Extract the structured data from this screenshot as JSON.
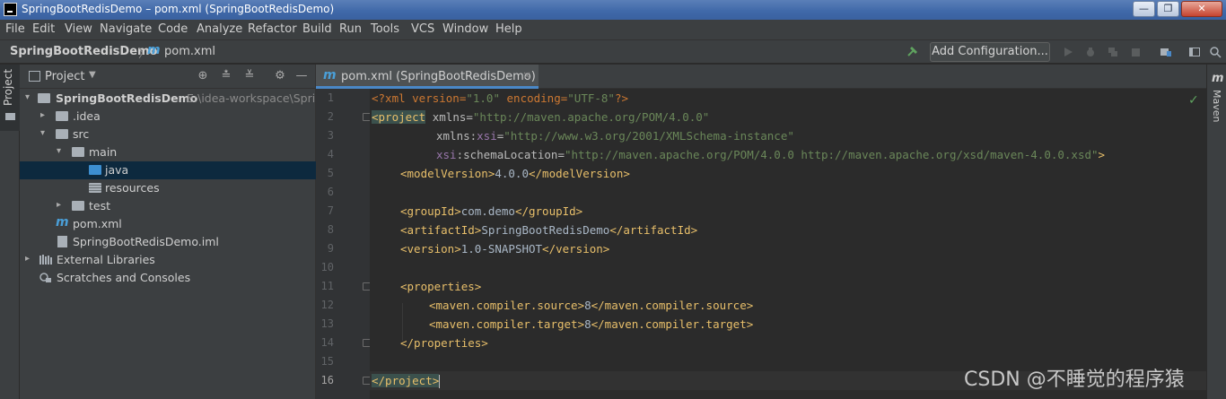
{
  "window": {
    "title": "SpringBootRedisDemo – pom.xml (SpringBootRedisDemo)",
    "min_label": "—",
    "max_label": "❐",
    "close_label": "✕"
  },
  "menu": [
    "File",
    "Edit",
    "View",
    "Navigate",
    "Code",
    "Analyze",
    "Refactor",
    "Build",
    "Run",
    "Tools",
    "VCS",
    "Window",
    "Help"
  ],
  "navbar": {
    "project": "SpringBootRedisDemo",
    "separator": "〉",
    "m_glyph": "m",
    "file": "pom.xml",
    "add_configuration": "Add Configuration..."
  },
  "left_strip": {
    "label": "Project"
  },
  "project_panel": {
    "title": "Project",
    "caret": "▼",
    "tree": [
      {
        "label": "SpringBootRedisDemo",
        "path": "E:\\idea-workspace\\Sprin",
        "arrow": "▾",
        "icon": "module-folder-icon"
      },
      {
        "label": ".idea",
        "arrow": "▸",
        "icon": "folder-icon"
      },
      {
        "label": "src",
        "arrow": "▾",
        "icon": "folder-icon"
      },
      {
        "label": "main",
        "arrow": "▾",
        "icon": "folder-icon"
      },
      {
        "label": "java",
        "arrow": "",
        "icon": "source-folder-icon"
      },
      {
        "label": "resources",
        "arrow": "",
        "icon": "resources-folder-icon"
      },
      {
        "label": "test",
        "arrow": "▸",
        "icon": "folder-icon"
      },
      {
        "label": "pom.xml",
        "arrow": "",
        "icon": "maven-icon"
      },
      {
        "label": "SpringBootRedisDemo.iml",
        "arrow": "",
        "icon": "iml-file-icon"
      },
      {
        "label": "External Libraries",
        "arrow": "▸",
        "icon": "libraries-icon"
      },
      {
        "label": "Scratches and Consoles",
        "arrow": "",
        "icon": "scratches-icon"
      }
    ]
  },
  "editor": {
    "tab_label": "pom.xml (SpringBootRedisDemo)",
    "tab_close": "×",
    "m_glyph": "m",
    "line_numbers": [
      "1",
      "2",
      "3",
      "4",
      "5",
      "6",
      "7",
      "8",
      "9",
      "10",
      "11",
      "12",
      "13",
      "14",
      "15",
      "16"
    ],
    "current_line": "16",
    "check": "✓"
  },
  "code": {
    "l1_a": "<?xml version=",
    "l1_b": "\"1.0\"",
    "l1_c": " encoding=",
    "l1_d": "\"UTF-8\"",
    "l1_e": "?>",
    "l2_tag": "<project",
    "l2_attr": " xmlns=",
    "l2_val": "\"http://maven.apache.org/POM/4.0.0\"",
    "l3_attr1": "xmlns:",
    "l3_ns": "xsi",
    "l3_eq": "=",
    "l3_val": "\"http://www.w3.org/2001/XMLSchema-instance\"",
    "l4_ns": "xsi",
    "l4_attr": ":schemaLocation=",
    "l4_val": "\"http://maven.apache.org/POM/4.0.0 http://maven.apache.org/xsd/maven-4.0.0.xsd\"",
    "l4_close": ">",
    "l5_open": "<modelVersion>",
    "l5_text": "4.0.0",
    "l5_close": "</modelVersion>",
    "l7_open": "<groupId>",
    "l7_text": "com.demo",
    "l7_close": "</groupId>",
    "l8_open": "<artifactId>",
    "l8_text": "SpringBootRedisDemo",
    "l8_close": "</artifactId>",
    "l9_open": "<version>",
    "l9_text": "1.0-SNAPSHOT",
    "l9_close": "</version>",
    "l11": "<properties>",
    "l12_open": "<maven.compiler.source>",
    "l12_text": "8",
    "l12_close": "</maven.compiler.source>",
    "l13_open": "<maven.compiler.target>",
    "l13_text": "8",
    "l13_close": "</maven.compiler.target>",
    "l14": "</properties>",
    "l16": "</project>"
  },
  "right_strip": {
    "m_glyph": "m",
    "label": "Maven"
  },
  "watermark": "CSDN @不睡觉的程序猿",
  "colors": {
    "tag": "#e8bf6a",
    "string": "#6a8759",
    "namespace": "#9876aa",
    "accent": "#4a88c7"
  }
}
